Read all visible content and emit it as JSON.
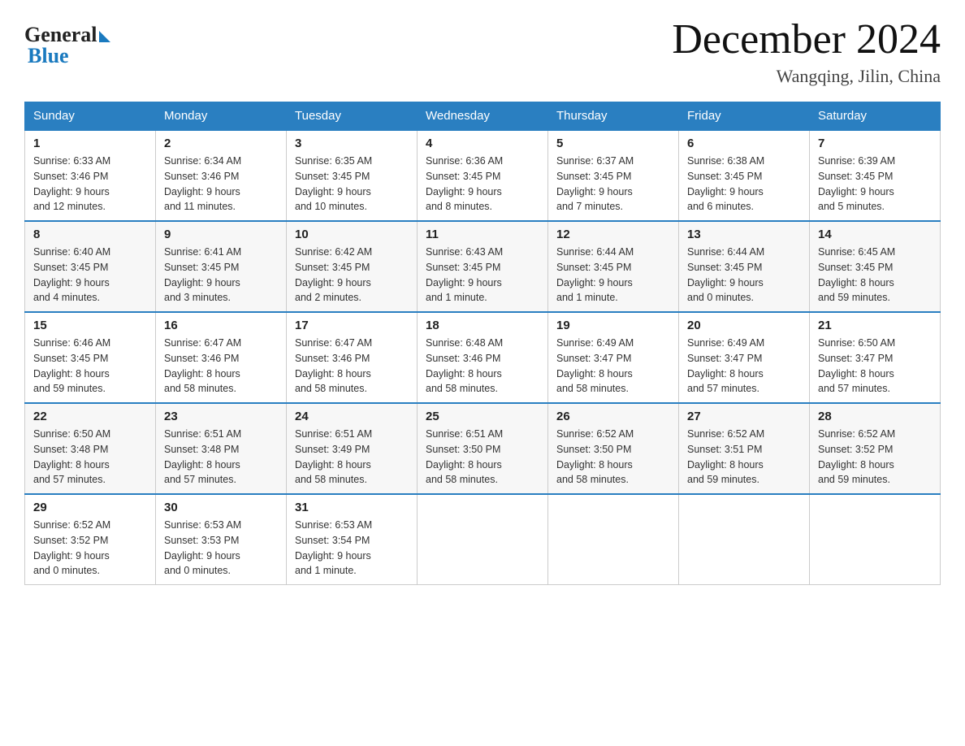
{
  "logo": {
    "general": "General",
    "blue": "Blue"
  },
  "title": "December 2024",
  "location": "Wangqing, Jilin, China",
  "weekdays": [
    "Sunday",
    "Monday",
    "Tuesday",
    "Wednesday",
    "Thursday",
    "Friday",
    "Saturday"
  ],
  "weeks": [
    [
      {
        "day": "1",
        "sunrise": "6:33 AM",
        "sunset": "3:46 PM",
        "daylight": "9 hours and 12 minutes."
      },
      {
        "day": "2",
        "sunrise": "6:34 AM",
        "sunset": "3:46 PM",
        "daylight": "9 hours and 11 minutes."
      },
      {
        "day": "3",
        "sunrise": "6:35 AM",
        "sunset": "3:45 PM",
        "daylight": "9 hours and 10 minutes."
      },
      {
        "day": "4",
        "sunrise": "6:36 AM",
        "sunset": "3:45 PM",
        "daylight": "9 hours and 8 minutes."
      },
      {
        "day": "5",
        "sunrise": "6:37 AM",
        "sunset": "3:45 PM",
        "daylight": "9 hours and 7 minutes."
      },
      {
        "day": "6",
        "sunrise": "6:38 AM",
        "sunset": "3:45 PM",
        "daylight": "9 hours and 6 minutes."
      },
      {
        "day": "7",
        "sunrise": "6:39 AM",
        "sunset": "3:45 PM",
        "daylight": "9 hours and 5 minutes."
      }
    ],
    [
      {
        "day": "8",
        "sunrise": "6:40 AM",
        "sunset": "3:45 PM",
        "daylight": "9 hours and 4 minutes."
      },
      {
        "day": "9",
        "sunrise": "6:41 AM",
        "sunset": "3:45 PM",
        "daylight": "9 hours and 3 minutes."
      },
      {
        "day": "10",
        "sunrise": "6:42 AM",
        "sunset": "3:45 PM",
        "daylight": "9 hours and 2 minutes."
      },
      {
        "day": "11",
        "sunrise": "6:43 AM",
        "sunset": "3:45 PM",
        "daylight": "9 hours and 1 minute."
      },
      {
        "day": "12",
        "sunrise": "6:44 AM",
        "sunset": "3:45 PM",
        "daylight": "9 hours and 1 minute."
      },
      {
        "day": "13",
        "sunrise": "6:44 AM",
        "sunset": "3:45 PM",
        "daylight": "9 hours and 0 minutes."
      },
      {
        "day": "14",
        "sunrise": "6:45 AM",
        "sunset": "3:45 PM",
        "daylight": "8 hours and 59 minutes."
      }
    ],
    [
      {
        "day": "15",
        "sunrise": "6:46 AM",
        "sunset": "3:45 PM",
        "daylight": "8 hours and 59 minutes."
      },
      {
        "day": "16",
        "sunrise": "6:47 AM",
        "sunset": "3:46 PM",
        "daylight": "8 hours and 58 minutes."
      },
      {
        "day": "17",
        "sunrise": "6:47 AM",
        "sunset": "3:46 PM",
        "daylight": "8 hours and 58 minutes."
      },
      {
        "day": "18",
        "sunrise": "6:48 AM",
        "sunset": "3:46 PM",
        "daylight": "8 hours and 58 minutes."
      },
      {
        "day": "19",
        "sunrise": "6:49 AM",
        "sunset": "3:47 PM",
        "daylight": "8 hours and 58 minutes."
      },
      {
        "day": "20",
        "sunrise": "6:49 AM",
        "sunset": "3:47 PM",
        "daylight": "8 hours and 57 minutes."
      },
      {
        "day": "21",
        "sunrise": "6:50 AM",
        "sunset": "3:47 PM",
        "daylight": "8 hours and 57 minutes."
      }
    ],
    [
      {
        "day": "22",
        "sunrise": "6:50 AM",
        "sunset": "3:48 PM",
        "daylight": "8 hours and 57 minutes."
      },
      {
        "day": "23",
        "sunrise": "6:51 AM",
        "sunset": "3:48 PM",
        "daylight": "8 hours and 57 minutes."
      },
      {
        "day": "24",
        "sunrise": "6:51 AM",
        "sunset": "3:49 PM",
        "daylight": "8 hours and 58 minutes."
      },
      {
        "day": "25",
        "sunrise": "6:51 AM",
        "sunset": "3:50 PM",
        "daylight": "8 hours and 58 minutes."
      },
      {
        "day": "26",
        "sunrise": "6:52 AM",
        "sunset": "3:50 PM",
        "daylight": "8 hours and 58 minutes."
      },
      {
        "day": "27",
        "sunrise": "6:52 AM",
        "sunset": "3:51 PM",
        "daylight": "8 hours and 59 minutes."
      },
      {
        "day": "28",
        "sunrise": "6:52 AM",
        "sunset": "3:52 PM",
        "daylight": "8 hours and 59 minutes."
      }
    ],
    [
      {
        "day": "29",
        "sunrise": "6:52 AM",
        "sunset": "3:52 PM",
        "daylight": "9 hours and 0 minutes."
      },
      {
        "day": "30",
        "sunrise": "6:53 AM",
        "sunset": "3:53 PM",
        "daylight": "9 hours and 0 minutes."
      },
      {
        "day": "31",
        "sunrise": "6:53 AM",
        "sunset": "3:54 PM",
        "daylight": "9 hours and 1 minute."
      },
      null,
      null,
      null,
      null
    ]
  ],
  "labels": {
    "sunrise": "Sunrise:",
    "sunset": "Sunset:",
    "daylight": "Daylight:"
  }
}
